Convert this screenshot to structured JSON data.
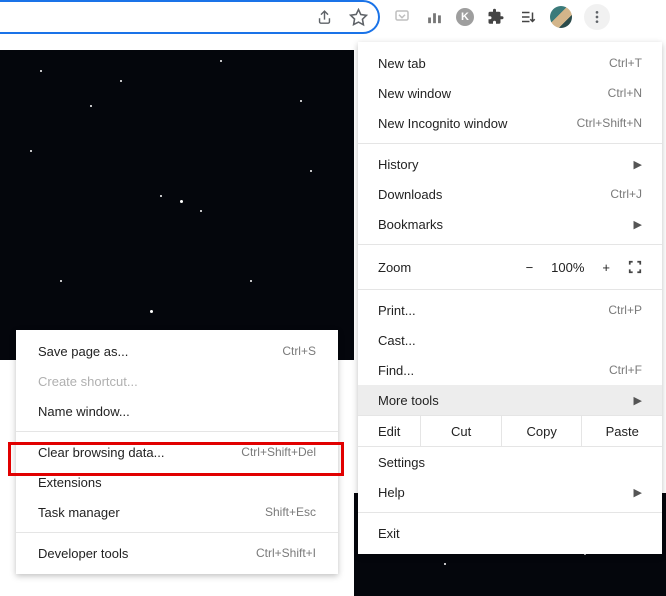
{
  "toolbar_icons": {
    "share": "share-icon",
    "star": "star-icon",
    "pocket": "pocket-icon",
    "chart": "chart-icon",
    "k": "K",
    "puzzle": "puzzle-icon",
    "playlist": "playlist-icon",
    "dots": "more-icon"
  },
  "main_menu": {
    "new_tab": {
      "label": "New tab",
      "shortcut": "Ctrl+T"
    },
    "new_window": {
      "label": "New window",
      "shortcut": "Ctrl+N"
    },
    "new_incognito": {
      "label": "New Incognito window",
      "shortcut": "Ctrl+Shift+N"
    },
    "history": {
      "label": "History"
    },
    "downloads": {
      "label": "Downloads",
      "shortcut": "Ctrl+J"
    },
    "bookmarks": {
      "label": "Bookmarks"
    },
    "zoom": {
      "label": "Zoom",
      "minus": "−",
      "pct": "100%",
      "plus": "+"
    },
    "print": {
      "label": "Print...",
      "shortcut": "Ctrl+P"
    },
    "cast": {
      "label": "Cast..."
    },
    "find": {
      "label": "Find...",
      "shortcut": "Ctrl+F"
    },
    "more_tools": {
      "label": "More tools"
    },
    "edit": {
      "label": "Edit",
      "cut": "Cut",
      "copy": "Copy",
      "paste": "Paste"
    },
    "settings": {
      "label": "Settings"
    },
    "help": {
      "label": "Help"
    },
    "exit": {
      "label": "Exit"
    }
  },
  "sub_menu": {
    "save_page": {
      "label": "Save page as...",
      "shortcut": "Ctrl+S"
    },
    "create_shortcut": {
      "label": "Create shortcut..."
    },
    "name_window": {
      "label": "Name window..."
    },
    "clear_data": {
      "label": "Clear browsing data...",
      "shortcut": "Ctrl+Shift+Del"
    },
    "extensions": {
      "label": "Extensions"
    },
    "task_manager": {
      "label": "Task manager",
      "shortcut": "Shift+Esc"
    },
    "developer_tools": {
      "label": "Developer tools",
      "shortcut": "Ctrl+Shift+I"
    }
  },
  "highlight_color": "#e10000"
}
